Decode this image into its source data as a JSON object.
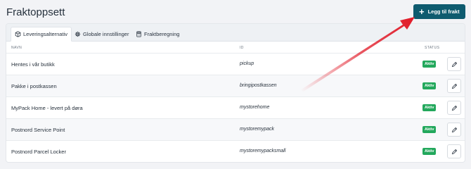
{
  "page": {
    "title": "Fraktoppsett"
  },
  "actions": {
    "add_shipping_label": "Legg til frakt",
    "add_icon": "plus-icon"
  },
  "tabs": [
    {
      "label": "Leveringsalternativ",
      "icon": "box-icon",
      "active": true
    },
    {
      "label": "Globale innstillinger",
      "icon": "gear-icon",
      "active": false
    },
    {
      "label": "Fraktberegning",
      "icon": "calculator-icon",
      "active": false
    }
  ],
  "table": {
    "columns": {
      "name": "NAVN",
      "id": "ID",
      "status": "STATUS"
    },
    "rows": [
      {
        "name": "Hentes i vår butikk",
        "id": "pickup",
        "status": "Aktiv"
      },
      {
        "name": "Pakke i postkassen",
        "id": "bringipostkassen",
        "status": "Aktiv"
      },
      {
        "name": "MyPack Home - levert på døra",
        "id": "mystorehome",
        "status": "Aktiv"
      },
      {
        "name": "Postnord Service Point",
        "id": "mystoremypack",
        "status": "Aktiv"
      },
      {
        "name": "Postnord Parcel Locker",
        "id": "mystoremypacksmall",
        "status": "Aktiv"
      }
    ]
  },
  "colors": {
    "accent": "#0e5b6f",
    "status_active": "#23a85c",
    "annotation_arrow": "#e11d2a"
  },
  "annotation": {
    "type": "arrow",
    "points_to": "add-shipping-button"
  }
}
